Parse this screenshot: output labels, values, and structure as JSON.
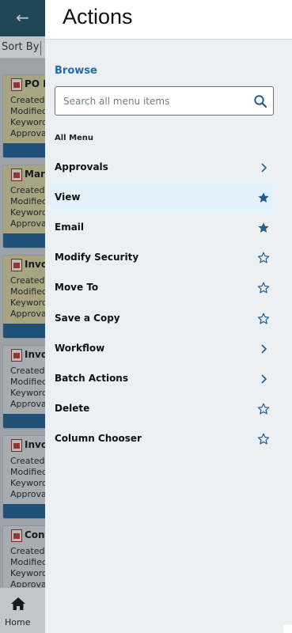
{
  "background": {
    "back_icon": "arrow-left-icon",
    "sort_label": "Sort By",
    "documents": [
      {
        "title": "PO E",
        "color": "yellow",
        "lines": [
          "Created",
          "Modified",
          "Keyword",
          "Approval"
        ]
      },
      {
        "title": "Mark",
        "color": "yellow",
        "lines": [
          "Created",
          "Modified",
          "Keyword",
          "Approval"
        ]
      },
      {
        "title": "Invoi",
        "color": "yellow",
        "lines": [
          "Created",
          "Modified",
          "Keyword",
          "Approval"
        ]
      },
      {
        "title": "Invoi",
        "color": "grey",
        "lines": [
          "Created",
          "Modified",
          "Keyword",
          "Approva"
        ]
      },
      {
        "title": "Invoi",
        "color": "grey",
        "lines": [
          "Created",
          "Modified",
          "Keyword",
          "Approva"
        ]
      },
      {
        "title": "Cont",
        "color": "grey",
        "lines": [
          "Created",
          "Modified",
          "Keyword",
          "Approva"
        ]
      }
    ],
    "bottom_nav": {
      "home_label": "Home",
      "home_icon": "home-icon"
    }
  },
  "panel": {
    "title": "Actions",
    "browse_label": "Browse",
    "search": {
      "placeholder": "Search all menu items",
      "value": "",
      "icon": "search-icon"
    },
    "all_menu_label": "All Menu",
    "items": [
      {
        "label": "Approvals",
        "trail": "chevron",
        "highlight": false
      },
      {
        "label": "View",
        "trail": "star-filled",
        "highlight": true
      },
      {
        "label": "Email",
        "trail": "star-filled",
        "highlight": false
      },
      {
        "label": "Modify Security",
        "trail": "star-outline",
        "highlight": false
      },
      {
        "label": "Move To",
        "trail": "star-outline",
        "highlight": false
      },
      {
        "label": "Save a Copy",
        "trail": "star-outline",
        "highlight": false
      },
      {
        "label": "Workflow",
        "trail": "chevron",
        "highlight": false
      },
      {
        "label": "Batch Actions",
        "trail": "chevron",
        "highlight": false
      },
      {
        "label": "Delete",
        "trail": "star-outline",
        "highlight": false
      },
      {
        "label": "Column Chooser",
        "trail": "star-outline",
        "highlight": false
      }
    ]
  },
  "colors": {
    "accent": "#1f6ea8",
    "header_dark": "#1d4f5f",
    "star": "#1f5e8c",
    "highlight_row": "#e3f1fb"
  }
}
